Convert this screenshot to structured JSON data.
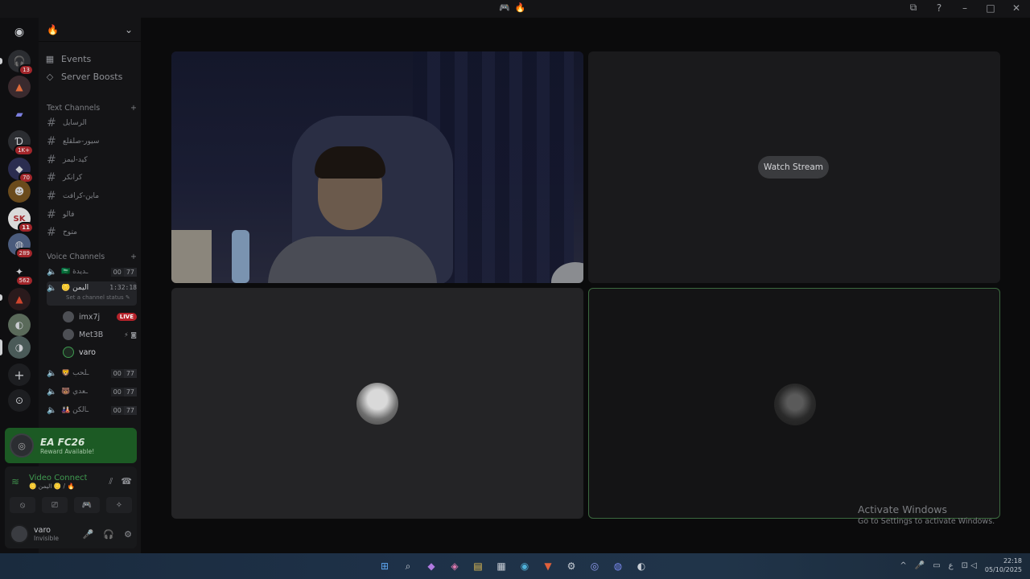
{
  "titlebar": {
    "center_icons": [
      "🎮",
      "🔥"
    ],
    "right_icons": [
      "⧉",
      "?",
      "–",
      "□",
      "✕"
    ]
  },
  "rail": {
    "discord_glyph": "◉",
    "servers": [
      {
        "glyph": "🎧",
        "badge": "13"
      },
      {
        "glyph": "▲",
        "badge": ""
      },
      {
        "glyph": "▰",
        "badge": ""
      },
      {
        "glyph": "Ɗ",
        "badge": "1K+"
      },
      {
        "glyph": "◆",
        "badge": "70"
      },
      {
        "glyph": "☻",
        "badge": ""
      },
      {
        "glyph": "SK",
        "badge": "11"
      },
      {
        "glyph": "◍",
        "badge": "289"
      },
      {
        "glyph": "✦",
        "badge": "562"
      },
      {
        "glyph": "▲",
        "badge": ""
      },
      {
        "glyph": "◐",
        "badge": ""
      },
      {
        "glyph": "◑",
        "badge": ""
      }
    ],
    "add_glyph": "+",
    "discover_glyph": "⊙"
  },
  "sidebar": {
    "guild_name": "🔥",
    "events": "Events",
    "boosts": "Server Boosts",
    "text_category": "Text Channels",
    "text_channels": [
      "الرسايل",
      "سيور-صلقلع",
      "كيد-ليمز",
      "كرانكر",
      "ماين-كرافت",
      "فالو",
      "متوح"
    ],
    "voice_category": "Voice Channels",
    "voice_channels": [
      {
        "name": "🇸🇦 ـديدة",
        "count_a": "00",
        "count_b": "77"
      },
      {
        "name": "🦁 ـلحب",
        "count_a": "00",
        "count_b": "77"
      },
      {
        "name": "🐻 ـعدي",
        "count_a": "00",
        "count_b": "77"
      },
      {
        "name": "🎎 ـالكن",
        "count_a": "00",
        "count_b": "77"
      }
    ],
    "active_channel": {
      "name": "🪙 اليمن",
      "timer": "1:32:18",
      "status": "Set a channel status ✎"
    },
    "members": [
      {
        "name": "imx7j",
        "tag": "LIVE",
        "trail": ""
      },
      {
        "name": "Met3B",
        "tag": "",
        "trail": "⚡ ◙"
      },
      {
        "name": "varo",
        "tag": "",
        "trail": ""
      }
    ]
  },
  "reward": {
    "logo": "◎",
    "title": "EA FC26",
    "subtitle": "Reward Available!"
  },
  "voice_panel": {
    "title": "Video Connected",
    "subtitle": "🪙 اليمن 🪙 / 🔥",
    "actions": [
      "⦸",
      "⎚",
      "🎮",
      "✧"
    ],
    "user_name": "varo",
    "user_status": "Invisible",
    "controls": [
      "🎤",
      "🎧",
      "⚙"
    ]
  },
  "stage": {
    "watch_stream": "Watch Stream"
  },
  "activation": {
    "line1": "Activate Windows",
    "line2": "Go to Settings to activate Windows."
  },
  "taskbar": {
    "icons": [
      "⊞",
      "⌕",
      "◆",
      "◈",
      "▤",
      "▦",
      "◉",
      "▼",
      "⚙",
      "◎",
      "◍",
      "◐"
    ],
    "tray": [
      "^",
      "🎤",
      "▭",
      "ع",
      "⊡ ◁"
    ],
    "time": "22:18",
    "date": "05/10/2025"
  }
}
